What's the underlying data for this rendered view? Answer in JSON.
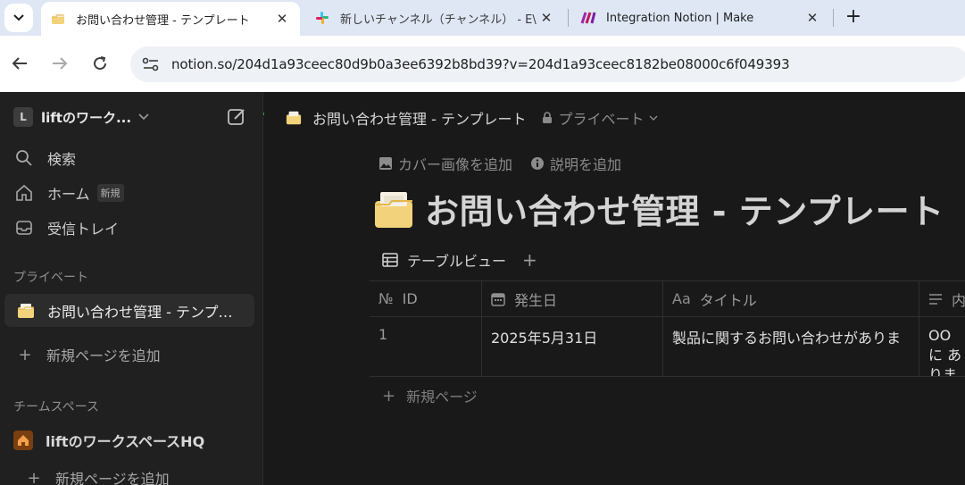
{
  "browser": {
    "tabs": [
      {
        "title": "お問い合わせ管理 - テンプレート",
        "icon": "notion-folder-icon",
        "active": true
      },
      {
        "title": "新しいチャンネル（チャンネル） - E\\",
        "icon": "slack-icon",
        "active": false
      },
      {
        "title": "Integration Notion | Make",
        "icon": "make-icon",
        "active": false
      }
    ],
    "close_glyph": "✕",
    "new_tab_glyph": "+",
    "url": "notion.so/204d1a93ceec80d9b0a3ee6392b8bd39?v=204d1a93ceec8182be08000c6f049393",
    "colors": {
      "underline": "#22a845"
    }
  },
  "sidebar": {
    "workspace_initial": "L",
    "workspace_name": "liftのワーク...",
    "items": [
      {
        "label": "検索",
        "icon": "search-icon"
      },
      {
        "label": "ホーム",
        "icon": "home-icon",
        "badge": "新規"
      },
      {
        "label": "受信トレイ",
        "icon": "inbox-icon"
      }
    ],
    "private_section": "プライベート",
    "private_page": "お問い合わせ管理 - テンプレート",
    "add_page": "新規ページを追加",
    "team_section": "チームスペース",
    "team_name": "liftのワークスペースHQ",
    "team_add_page": "新規ページを追加"
  },
  "main": {
    "breadcrumb": "お問い合わせ管理 - テンプレート",
    "privacy": "プライベート",
    "add_cover": "カバー画像を追加",
    "add_description": "説明を追加",
    "title": "お問い合わせ管理 - テンプレート",
    "view_name": "テーブルビュー",
    "columns": [
      {
        "label": "ID",
        "icon": "number-icon",
        "icon_text": "№"
      },
      {
        "label": "発生日",
        "icon": "calendar-icon"
      },
      {
        "label": "タイトル",
        "icon": "text-icon",
        "icon_text": "Aa"
      },
      {
        "label": "内",
        "icon": "lines-icon"
      }
    ],
    "rows": [
      {
        "id": "1",
        "date": "2025年5月31日",
        "title": "製品に関するお問い合わせがありま",
        "content": "OOに ありま"
      }
    ],
    "new_row": "新規ページ"
  }
}
